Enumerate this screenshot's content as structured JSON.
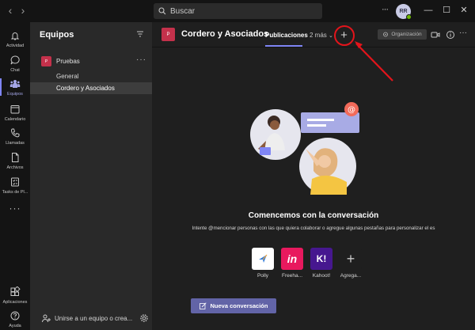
{
  "titlebar": {
    "search_placeholder": "Buscar",
    "avatar_initials": "RR",
    "back_glyph": "‹",
    "forward_glyph": "›",
    "more_glyph": "···",
    "minimize_glyph": "—",
    "maximize_glyph": "☐",
    "close_glyph": "✕"
  },
  "rail": {
    "items": [
      {
        "label": "Actividad",
        "icon": "bell-icon"
      },
      {
        "label": "Chat",
        "icon": "chat-icon"
      },
      {
        "label": "Equipos",
        "icon": "teams-icon",
        "active": true
      },
      {
        "label": "Calendario",
        "icon": "calendar-icon"
      },
      {
        "label": "Llamadas",
        "icon": "phone-icon"
      },
      {
        "label": "Archivos",
        "icon": "file-icon"
      },
      {
        "label": "Tasks de Pl...",
        "icon": "tasks-icon"
      }
    ],
    "more": "···",
    "bottom": [
      {
        "label": "Aplicaciones",
        "icon": "apps-icon"
      },
      {
        "label": "Ayuda",
        "icon": "help-icon"
      }
    ]
  },
  "teams_panel": {
    "title": "Equipos",
    "team": {
      "badge": "P",
      "name": "Pruebas",
      "more": "···"
    },
    "channels": [
      {
        "name": "General",
        "selected": false
      },
      {
        "name": "Cordero y Asociados",
        "selected": true
      }
    ],
    "join_label": "Unirse a un equipo o crea..."
  },
  "channel_header": {
    "badge": "P",
    "title": "Cordero y Asociados",
    "tab_active": "Publicaciones",
    "tab_more": "2 más",
    "add_tab": "+",
    "org_label": "Organización"
  },
  "empty_state": {
    "title": "Comencemos con la conversación",
    "subtitle": "Intente @mencionar personas con las que quiera colaborar o agregue algunas pestañas para personalizar el es",
    "bubble_at": "@"
  },
  "apps": [
    {
      "name": "Polly",
      "glyph": "✈",
      "bg": "#ffffff",
      "fg": "#2f7bd9"
    },
    {
      "name": "Freeha...",
      "glyph": "in",
      "bg": "#e8195e",
      "fg": "#ffffff"
    },
    {
      "name": "Kahoot!",
      "glyph": "K!",
      "bg": "#46178f",
      "fg": "#ffffff"
    },
    {
      "name": "Agrega...",
      "glyph": "+",
      "bg": "#1f1f1f",
      "fg": "#c8c8c8"
    }
  ],
  "new_conversation_label": "Nueva conversación",
  "colors": {
    "accent": "#6264a7",
    "team_badge": "#c4314b",
    "annotation": "#e3141b",
    "presence": "#6bb700"
  }
}
